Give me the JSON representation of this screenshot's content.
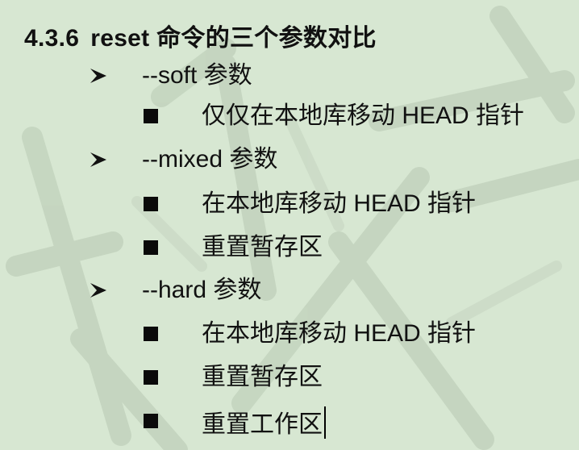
{
  "section": {
    "number": "4.3.6",
    "title": "reset 命令的三个参数对比"
  },
  "params": [
    {
      "label": "--soft 参数",
      "items": [
        "仅仅在本地库移动 HEAD 指针"
      ]
    },
    {
      "label": "--mixed 参数",
      "items": [
        "在本地库移动 HEAD 指针",
        "重置暂存区"
      ]
    },
    {
      "label": "--hard 参数",
      "items": [
        "在本地库移动 HEAD 指针",
        "重置暂存区",
        "重置工作区"
      ]
    }
  ],
  "icons": {
    "level1_marker": "arrowhead-bullet-icon",
    "level2_marker": "square-bullet-icon"
  },
  "colors": {
    "background": "#d7e7d2",
    "text": "#111111",
    "watermark": "#c3d2bd"
  }
}
